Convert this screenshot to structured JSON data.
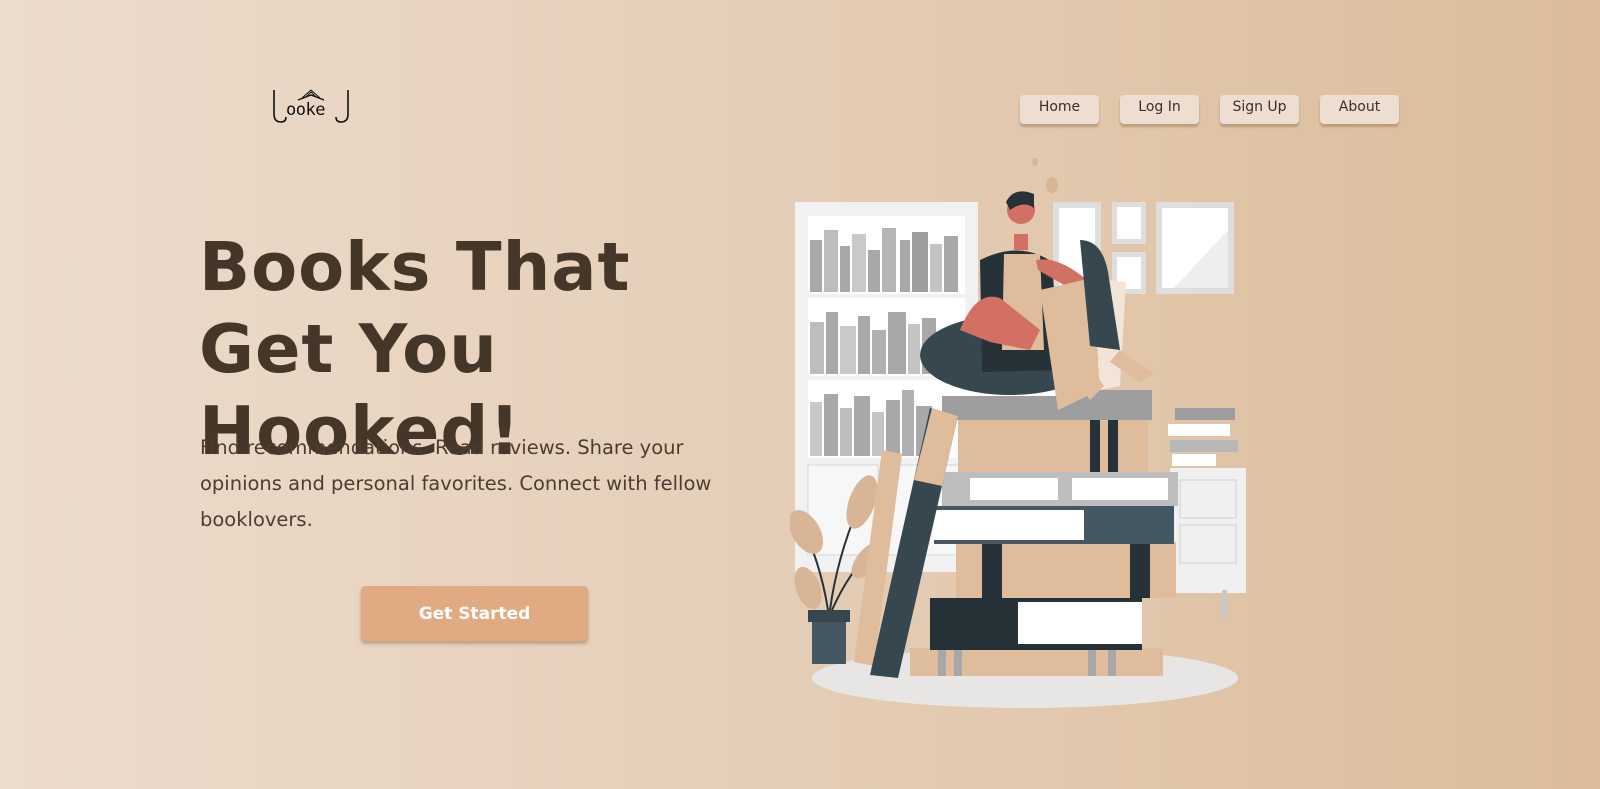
{
  "brand": {
    "logo_text": "ooke"
  },
  "nav": {
    "items": [
      "Home",
      "Log In",
      "Sign Up",
      "About"
    ]
  },
  "hero": {
    "title": "Books That Get You Hooked!",
    "subtitle": "Find recommendations. Read reviews. Share your opinions and personal favorites. Connect with fellow booklovers.",
    "cta": "Get Started"
  },
  "illustration": {
    "name": "person-reading-on-book-stack-illustration"
  }
}
